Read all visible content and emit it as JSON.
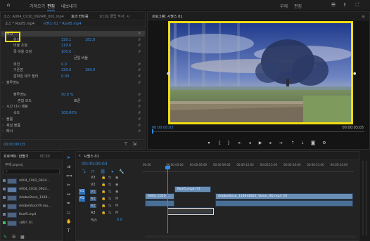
{
  "topbar": {
    "tabs": [
      "가져오기",
      "편집",
      "내보내기"
    ],
    "active_tab": "편집",
    "center_tabs": [
      "부제",
      "편집"
    ],
    "icons": [
      "home-icon",
      "quick-export-icon",
      "fullscreen-icon"
    ]
  },
  "source_panel": {
    "tabs": [
      "소스: A004_C010_0924I6_001.mp4",
      "효과 컨트롤",
      "오디오 클립 믹서: 시",
      "메타데이터"
    ],
    "subtabs": [
      "소스 * Roof5.mp4",
      "시퀀스 01 * Roof5.mp4"
    ],
    "rows": [
      {
        "label": "모션",
        "value": "",
        "extra": ""
      },
      {
        "label": "위치",
        "value": "320.1",
        "extra": "182.8"
      },
      {
        "label": "비율 조정",
        "value": "110.6",
        "extra": ""
      },
      {
        "label": "폭 비율 조정",
        "value": "100.0",
        "extra": ""
      },
      {
        "label": "",
        "value": "",
        "extra": "균일 비율"
      },
      {
        "label": "회전",
        "value": "0.0",
        "extra": ""
      },
      {
        "label": "기준점",
        "value": "320.0",
        "extra": "180.0"
      },
      {
        "label": "깜박임 제거 필터",
        "value": "0.00",
        "extra": ""
      },
      {
        "label": "불투명도",
        "value": "",
        "extra": ""
      },
      {
        "label": "",
        "value": "",
        "extra": ""
      },
      {
        "label": "불투명도",
        "value": "50.0 %",
        "extra": ""
      },
      {
        "label": "혼합 모드",
        "value": "",
        "extra": "표준"
      },
      {
        "label": "시간 다시 매핑",
        "value": "",
        "extra": ""
      },
      {
        "label": "속도",
        "value": "100.00%",
        "extra": ""
      },
      {
        "label": "볼륨",
        "value": "",
        "extra": ""
      },
      {
        "label": "채널 볼륨",
        "value": "",
        "extra": ""
      },
      {
        "label": "패너",
        "value": "",
        "extra": ""
      }
    ],
    "timecode": "00:00:00:03"
  },
  "program_monitor": {
    "tab": "프로그램: 시퀀스 01",
    "timecode_left": "00:00:00:03",
    "timecode_right": "00:00:03:03",
    "fit_label": "맞추기"
  },
  "project_panel": {
    "tabs": [
      "프로젝트: 만들기",
      "미디어"
    ],
    "name": "무제.prproj",
    "search_placeholder": "",
    "items": [
      "A004_C002_0924...",
      "A004_C010_0924...",
      "AdobeStock_1180...",
      "AdobeStockYR.mp...",
      "Roof5.mp4",
      "시퀀스 01"
    ]
  },
  "timeline": {
    "tab": "시퀀스 01",
    "timecode": "00:00:00:03",
    "ruler": [
      "00:00",
      "00:00:03:00",
      "00:00:06:00",
      "00:00:09:00",
      "00:00:12:00",
      "00:00:15:00",
      "00:00:18:00",
      "00:00:21:00",
      "00:00:24:00"
    ],
    "tracks": [
      "V3",
      "V2",
      "V1",
      "A1",
      "A2",
      "A3",
      "믹스"
    ],
    "master_value": "0.0",
    "clips": {
      "v2": "Roof5.mp4 [V]",
      "v1_a": "A004_C010_...",
      "v1_b": "AdobeStock_118648822_Video_HD.mp4 [V]"
    }
  },
  "colors": {
    "accent": "#2d8ceb",
    "highlight": "#f0dc13",
    "clip_video": "#6a8fb6",
    "clip_audio": "#4a6f97",
    "playhead": "#2d8ceb"
  }
}
